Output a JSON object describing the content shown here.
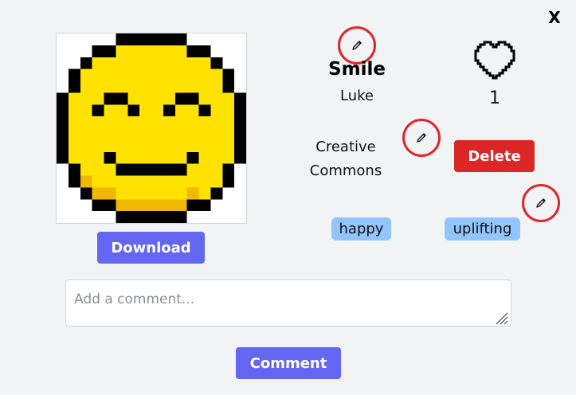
{
  "modal": {
    "close_label": "X",
    "title": "Smile",
    "author": "Luke",
    "license_line1": "Creative",
    "license_line2": "Commons",
    "likes": "1",
    "download_label": "Download",
    "delete_label": "Delete",
    "tags": [
      "happy",
      "uplifting"
    ],
    "comment_placeholder": "Add a comment...",
    "comment_value": "",
    "comment_button_label": "Comment"
  },
  "icons": {
    "close": "close-icon",
    "heart": "heart-outline-icon",
    "edit": "pencil-icon",
    "art": "pixel-smiley-art"
  },
  "colors": {
    "accent_button": "#6366f1",
    "danger_button": "#dc2626",
    "tag_bg": "#93c5fd",
    "edit_ring": "#e0262b",
    "smiley_yellow": "#ffe200"
  }
}
